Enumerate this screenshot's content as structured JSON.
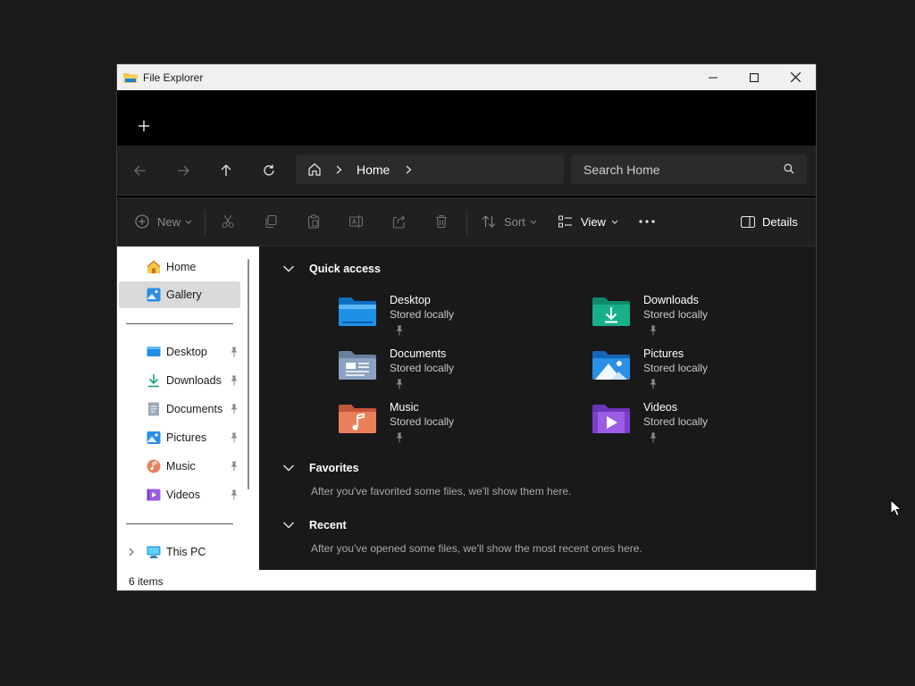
{
  "window": {
    "title": "File Explorer"
  },
  "navbar": {
    "breadcrumb": "Home",
    "search_placeholder": "Search Home"
  },
  "toolbar": {
    "new_label": "New",
    "sort_label": "Sort",
    "view_label": "View",
    "details_label": "Details"
  },
  "sidebar": {
    "home_label": "Home",
    "gallery_label": "Gallery",
    "items": [
      {
        "label": "Desktop",
        "icon": "desktop-icon"
      },
      {
        "label": "Downloads",
        "icon": "downloads-icon"
      },
      {
        "label": "Documents",
        "icon": "documents-icon"
      },
      {
        "label": "Pictures",
        "icon": "pictures-icon"
      },
      {
        "label": "Music",
        "icon": "music-icon"
      },
      {
        "label": "Videos",
        "icon": "videos-icon"
      }
    ],
    "this_pc_label": "This PC"
  },
  "main": {
    "quick_access_title": "Quick access",
    "quick_access": [
      {
        "name": "Desktop",
        "status": "Stored locally",
        "color": "#1e90e6"
      },
      {
        "name": "Downloads",
        "status": "Stored locally",
        "color": "#17b08a"
      },
      {
        "name": "Documents",
        "status": "Stored locally",
        "color": "#8aa3c2"
      },
      {
        "name": "Pictures",
        "status": "Stored locally",
        "color": "#2a8fe6"
      },
      {
        "name": "Music",
        "status": "Stored locally",
        "color": "#e9805a"
      },
      {
        "name": "Videos",
        "status": "Stored locally",
        "color": "#9b5de5"
      }
    ],
    "favorites_title": "Favorites",
    "favorites_empty": "After you've favorited some files, we'll show them here.",
    "recent_title": "Recent",
    "recent_empty": "After you've opened some files, we'll show the most recent ones here."
  },
  "status": {
    "item_count": "6 items"
  }
}
